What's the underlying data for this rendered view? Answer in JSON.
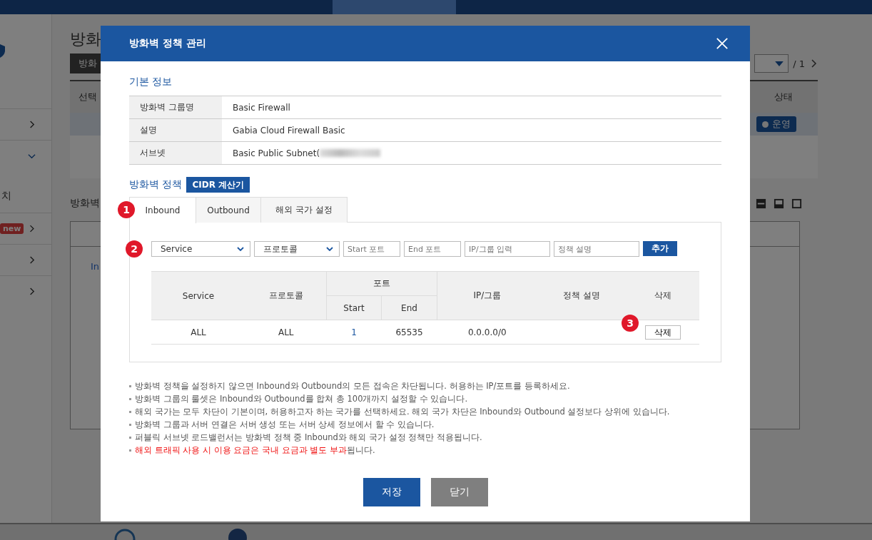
{
  "nav": [
    {
      "selected": false
    },
    {
      "selected": false
    },
    {
      "selected": true
    },
    {
      "selected": false
    },
    {
      "selected": false
    },
    {
      "selected": false
    }
  ],
  "sidebar": [
    {
      "expanded": false
    },
    {
      "expanded": true,
      "children": [
        {
          "label": "치"
        }
      ]
    },
    {
      "expanded": false,
      "badge": "new"
    },
    {
      "expanded": false
    },
    {
      "expanded": false
    }
  ],
  "page": {
    "title": "방화",
    "action_button": "방화",
    "pager": "/ 1",
    "table_headers": [
      "선택",
      "상태"
    ],
    "row_status": "운영",
    "section_title": "방화벽",
    "panel_text": "In"
  },
  "dialog": {
    "title": "방화벽 정책 관리",
    "basic_info": {
      "heading": "기본 정보",
      "rows": [
        {
          "label": "방화벽 그룹명",
          "value": "Basic Firewall",
          "redacted": false
        },
        {
          "label": "설명",
          "value": "Gabia Cloud Firewall Basic",
          "redacted": false
        },
        {
          "label": "서브넷",
          "value": "Basic Public Subnet(",
          "redacted": true
        }
      ]
    },
    "policy": {
      "heading": "방화벽 정책",
      "calculator_button": "CIDR 계산기",
      "tabs": [
        {
          "label": "Inbound",
          "selected": true
        },
        {
          "label": "Outbound",
          "selected": false
        },
        {
          "label": "해외 국가 설정",
          "selected": false
        }
      ],
      "form": {
        "service_select": "Service",
        "protocol_select": "프로토콜",
        "start_port": {
          "placeholder": "Start 포트"
        },
        "end_port": {
          "placeholder": "End 포트"
        },
        "ip_group": {
          "placeholder": "IP/그룹 입력"
        },
        "description": {
          "placeholder": "정책 설명"
        },
        "add_button": "추가"
      },
      "table": {
        "columns": {
          "service": "Service",
          "protocol": "프로토콜",
          "port": "포트",
          "start": "Start",
          "end": "End",
          "ip_group": "IP/그룹",
          "description": "정책 설명",
          "delete": "삭제"
        },
        "rows": [
          {
            "service": "ALL",
            "protocol": "ALL",
            "start": "1",
            "end": "65535",
            "ip_group": "0.0.0.0/0",
            "delete_button": "삭제"
          }
        ]
      }
    },
    "markers": [
      "1",
      "2",
      "3"
    ],
    "notes": [
      {
        "segments": [
          {
            "text": "방화벽 정책을 설정하지 않으면 Inbound와 Outbound의 모든 접속은 차단됩니다. 허용하는 IP/포트를 등록하세요.",
            "alert": false
          }
        ]
      },
      {
        "segments": [
          {
            "text": "방화벽 그룹의 룰셋은 Inbound와 Outbound를 합쳐 총 100개까지 설정할 수 있습니다.",
            "alert": false
          }
        ]
      },
      {
        "segments": [
          {
            "text": "해외 국가는 모두 차단이 기본이며, 허용하고자 하는 국가를 선택하세요. 해외 국가 차단은 Inbound와 Outbound 설정보다 상위에 있습니다.",
            "alert": false
          }
        ]
      },
      {
        "segments": [
          {
            "text": "방화벽 그룹과 서버 연결은 서버 생성 또는 서버 상세 정보에서 할 수 있습니다.",
            "alert": false
          }
        ]
      },
      {
        "segments": [
          {
            "text": "퍼블릭 서브넷 로드밸런서는 방화벽 정책 중 Inbound와 해외 국가 설정 정책만 적용됩니다.",
            "alert": false
          }
        ]
      },
      {
        "segments": [
          {
            "text": "해외 트래픽 사용 시 이용 요금은 국내 요금과 별도 부과",
            "alert": true
          },
          {
            "text": "됩니다.",
            "alert": false
          }
        ]
      }
    ],
    "save_button": "저장",
    "close_button": "닫기"
  }
}
